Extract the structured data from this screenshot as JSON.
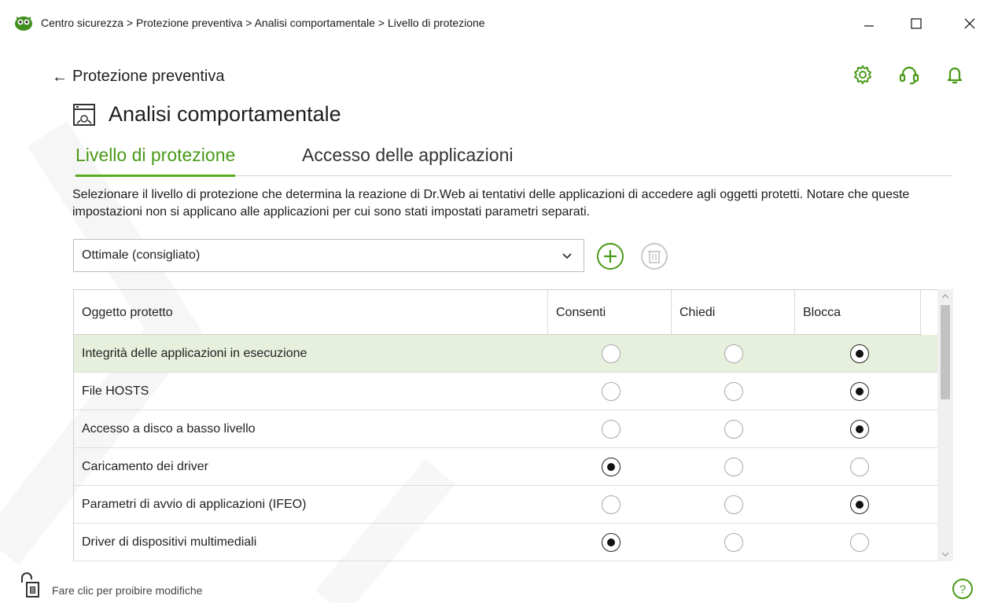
{
  "window": {
    "breadcrumb": "Centro sicurezza > Protezione preventiva > Analisi comportamentale > Livello di protezione",
    "minimize": "—",
    "maximize": "☐",
    "close": "✕"
  },
  "header": {
    "back_arrow": "←",
    "back_label": "Protezione preventiva",
    "tool_icons": [
      "gear-icon",
      "headset-icon",
      "bell-icon"
    ],
    "section_title": "Analisi comportamentale"
  },
  "tabs": [
    {
      "label": "Livello di protezione",
      "active": true
    },
    {
      "label": "Accesso delle applicazioni",
      "active": false
    }
  ],
  "description": "Selezionare il livello di protezione che determina la reazione di Dr.Web ai tentativi delle applicazioni di accedere agli oggetti protetti. Notare che queste impostazioni non si applicano alle applicazioni per cui sono stati impostati parametri separati.",
  "level_select": {
    "value": "Ottimale (consigliato)"
  },
  "table": {
    "columns": [
      "Oggetto protetto",
      "Consenti",
      "Chiedi",
      "Blocca"
    ],
    "rows": [
      {
        "label": "Integrità delle applicazioni in esecuzione",
        "choice": "Blocca",
        "selected": true
      },
      {
        "label": "File HOSTS",
        "choice": "Blocca",
        "selected": false
      },
      {
        "label": "Accesso a disco a basso livello",
        "choice": "Blocca",
        "selected": false
      },
      {
        "label": "Caricamento dei driver",
        "choice": "Consenti",
        "selected": false
      },
      {
        "label": "Parametri di avvio di applicazioni (IFEO)",
        "choice": "Blocca",
        "selected": false
      },
      {
        "label": "Driver di dispositivi multimediali",
        "choice": "Consenti",
        "selected": false
      }
    ]
  },
  "footer": {
    "lock_text": "Fare clic per proibire modifiche",
    "help_glyph": "?"
  },
  "colors": {
    "accent": "#5aab1f",
    "selected_row": "#e6f0dc"
  }
}
